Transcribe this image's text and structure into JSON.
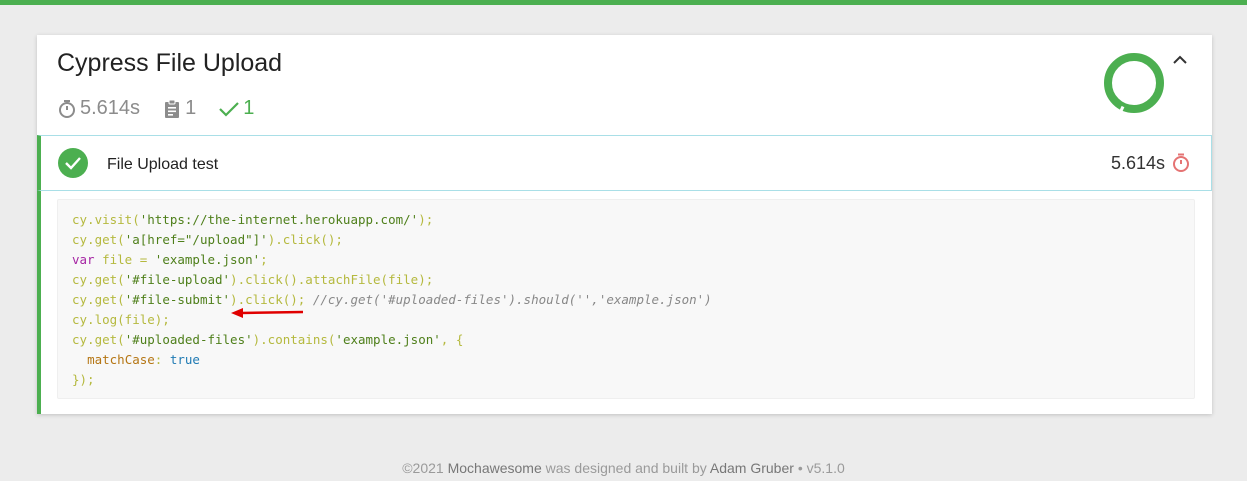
{
  "colors": {
    "pass": "#4caf50",
    "accent_border": "#a9dfe7",
    "duration_icon": "#e57373",
    "arrow": "#e00000"
  },
  "suite": {
    "title": "Cypress File Upload",
    "duration": "5.614s",
    "tests_count": "1",
    "passes_count": "1",
    "icons": {
      "duration": "stopwatch-icon",
      "tests": "clipboard-icon",
      "passes": "checkmark-icon",
      "collapse": "chevron-up-icon"
    },
    "pass_ratio": 1.0
  },
  "test": {
    "title": "File Upload test",
    "duration": "5.614s",
    "status": "passed"
  },
  "code_tokens": [
    [
      "cy.visit(",
      "'https://the-internet.herokuapp.com/'",
      ");"
    ],
    [
      "cy.get(",
      "'a[href=\"/upload\"]'",
      ").click();"
    ],
    [
      "var",
      " file = ",
      "'example.json'",
      ";"
    ],
    [
      "cy.get(",
      "'#file-upload'",
      ").click().attachFile(file);"
    ],
    [
      "cy.get(",
      "'#file-submit'",
      ").click(); ",
      "//cy.get('#uploaded-files').should('','example.json')"
    ],
    [
      "cy.log(file);"
    ],
    [
      "cy.get(",
      "'#uploaded-files'",
      ").contains(",
      "'example.json'",
      ", {"
    ],
    [
      "  ",
      "matchCase",
      ": ",
      "true"
    ],
    [
      "});"
    ]
  ],
  "footer": {
    "copyright": "©2021",
    "brand": "Mochawesome",
    "mid": "was designed and built by",
    "author": "Adam Gruber",
    "version": "• v5.1.0"
  }
}
